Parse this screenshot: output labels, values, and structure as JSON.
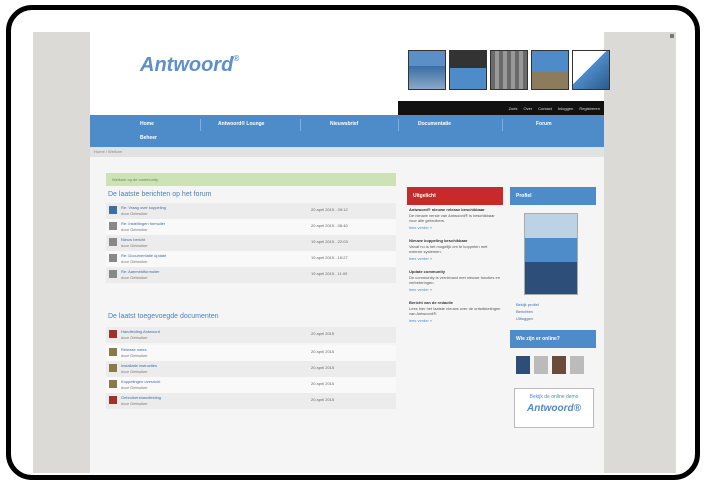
{
  "site": {
    "logo": "Antwoord",
    "logo_mark": "®"
  },
  "topbar": {
    "links": [
      "Zoek",
      "Over",
      "Contact",
      "Inloggen",
      "Registreren"
    ]
  },
  "nav": {
    "items": [
      "Home",
      "Antwoord® Lounge",
      "Nieuwsbrief",
      "Documentatie",
      "Forum",
      "Beheer"
    ]
  },
  "breadcrumb": "Home / Welkom",
  "welcome": "Welkom op de community",
  "sections": {
    "forum_title": "De laatste berichten op het forum",
    "docs_title": "De laatst toegevoegde documenten"
  },
  "forum_posts": [
    {
      "title": "Re: Vraag over koppeling",
      "by": "door Gebruiker",
      "date": "20 april 2015 - 09:12"
    },
    {
      "title": "Re: Instellingen formulier",
      "by": "door Gebruiker",
      "date": "20 april 2015 - 08:40"
    },
    {
      "title": "Nieuw bericht",
      "by": "door Gebruiker",
      "date": "19 april 2015 - 22:03"
    },
    {
      "title": "Re: Documentatie update",
      "by": "door Gebruiker",
      "date": "19 april 2015 - 16:27"
    },
    {
      "title": "Re: Aanmeldformulier",
      "by": "door Gebruiker",
      "date": "19 april 2015 - 11:09"
    }
  ],
  "documents": [
    {
      "title": "Handleiding Antwoord",
      "by": "door Gebruiker",
      "date": "20 april 2015"
    },
    {
      "title": "Release notes",
      "by": "door Gebruiker",
      "date": "20 april 2015"
    },
    {
      "title": "Installatie instructies",
      "by": "door Gebruiker",
      "date": "20 april 2015"
    },
    {
      "title": "Koppelingen overzicht",
      "by": "door Gebruiker",
      "date": "20 april 2015"
    },
    {
      "title": "Gebruikershandleiding",
      "by": "door Gebruiker",
      "date": "20 april 2015"
    }
  ],
  "news": {
    "heading": "Uitgelicht",
    "items": [
      {
        "title": "Antwoord® nieuwe release beschikbaar",
        "body": "De nieuwe versie van Antwoord® is beschikbaar voor alle gebruikers.",
        "more": "lees verder »"
      },
      {
        "title": "Nieuwe koppeling beschikbaar",
        "body": "Vanaf nu is het mogelijk om te koppelen met externe systemen.",
        "more": "lees verder »"
      },
      {
        "title": "Update community",
        "body": "De community is vernieuwd met nieuwe functies en verbeteringen.",
        "more": "lees verder »"
      },
      {
        "title": "Bericht van de redactie",
        "body": "Lees hier het laatste nieuws over de ontwikkelingen van Antwoord®.",
        "more": "lees verder »"
      }
    ]
  },
  "profile": {
    "heading": "Profiel",
    "links": [
      "Bekijk profiel",
      "Berichten",
      "Uitloggen"
    ]
  },
  "online": {
    "heading": "Wie zijn er online?"
  },
  "banner": {
    "line1": "Bekijk de online demo",
    "line2": "Antwoord®"
  },
  "colors": {
    "nav": "#4e8cc9",
    "news": "#c62a2a",
    "accent": "#5d8fc9"
  }
}
